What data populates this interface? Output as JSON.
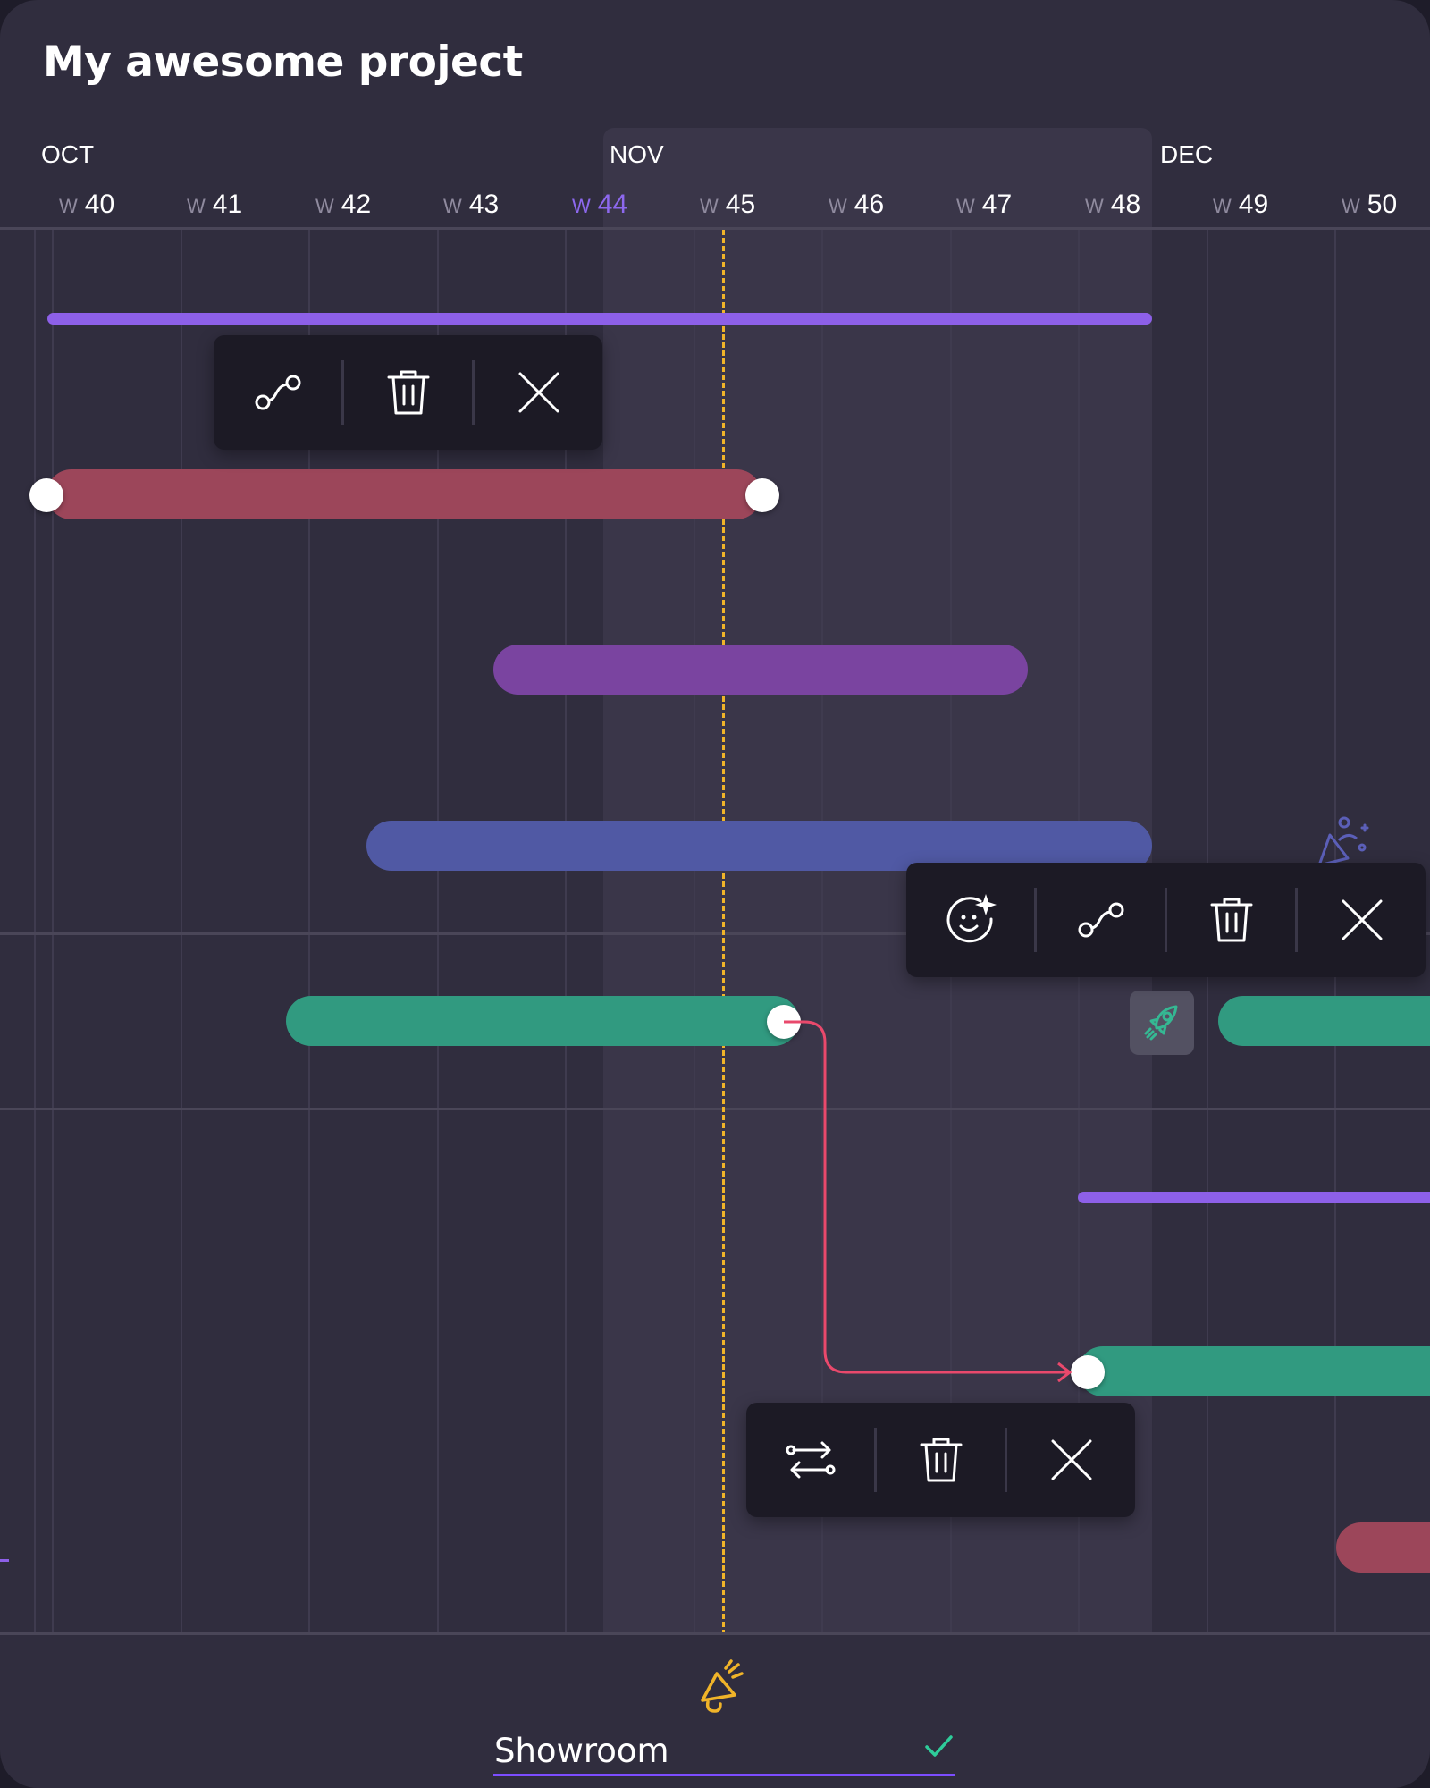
{
  "project": {
    "title": "My awesome project"
  },
  "timeline": {
    "months": [
      "OCT",
      "NOV",
      "DEC"
    ],
    "week_prefix": "W",
    "weeks": [
      "40",
      "41",
      "42",
      "43",
      "44",
      "45",
      "46",
      "47",
      "48",
      "49",
      "50"
    ],
    "current_week": "44"
  },
  "toolbars": {
    "top": [
      "dependency-icon",
      "trash-icon",
      "close-icon"
    ],
    "right": [
      "emoji-sparkle-icon",
      "dependency-icon",
      "trash-icon",
      "close-icon"
    ],
    "bottom": [
      "swap-arrows-icon",
      "trash-icon",
      "close-icon"
    ]
  },
  "colors": {
    "background": "#302d3e",
    "highlight_band": "#3a3649",
    "today_line": "#f0b429",
    "purple_thin": "#8d60e8",
    "red_bar": "#9c465a",
    "purple_bar": "#7a44a0",
    "blue_bar": "#5059a4",
    "green_bar": "#319a80",
    "connector": "#e9496c",
    "accent_underline": "#7c4dff",
    "check": "#2ecc9a"
  },
  "footer": {
    "item_label": "Showroom",
    "icon": "megaphone-icon",
    "status_icon": "check-icon"
  }
}
